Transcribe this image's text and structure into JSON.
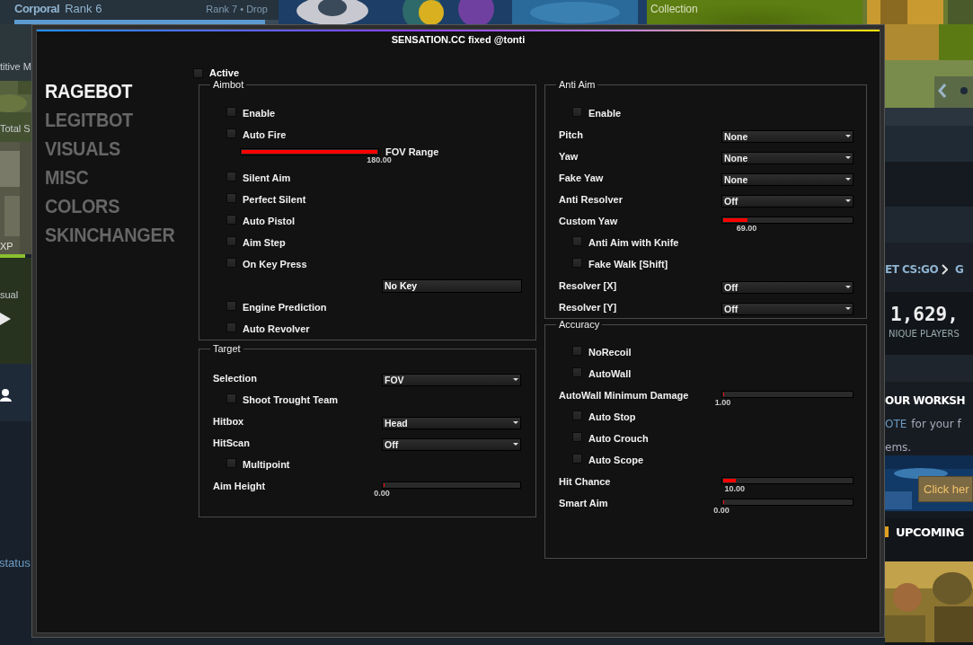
{
  "background": {
    "rank": {
      "title": "Corporal",
      "rank": "Rank 6",
      "next": "Rank 7 • Drop",
      "level": 0.95
    },
    "banner": "Collection",
    "left": {
      "mode": "titive M",
      "stats": "Total S",
      "xp": "XP",
      "mode2": "sual",
      "status": "status"
    },
    "right": {
      "nav": "ET CS:GO",
      "nav_next": "G",
      "count": "1,629,",
      "count_label": "NIQUE PLAYERS",
      "workshop_title": "OUR WORKSH",
      "workshop_link": "OTE",
      "workshop_text": "for your f",
      "workshop_text2": "ems.",
      "cta": "Click her",
      "upcoming": "UPCOMING"
    }
  },
  "menu": {
    "title": "SENSATION.CC fixed @tonti",
    "tabs": [
      {
        "label": "RAGEBOT",
        "selected": true
      },
      {
        "label": "LEGITBOT",
        "selected": false
      },
      {
        "label": "VISUALS",
        "selected": false
      },
      {
        "label": "MISC",
        "selected": false
      },
      {
        "label": "COLORS",
        "selected": false
      },
      {
        "label": "SKINCHANGER",
        "selected": false
      }
    ],
    "active": {
      "label": "Active",
      "checked": false
    },
    "columns": [
      [
        {
          "title": "Aimbot",
          "items": [
            {
              "kind": "checkbox",
              "label": "Enable",
              "checked": false
            },
            {
              "kind": "checkbox",
              "label": "Auto Fire",
              "checked": false
            },
            {
              "kind": "inline-slider",
              "label": "FOV Range",
              "level": 1,
              "reading": "180.00"
            },
            {
              "kind": "checkbox",
              "label": "Silent Aim",
              "checked": false
            },
            {
              "kind": "checkbox",
              "label": "Perfect Silent",
              "checked": false
            },
            {
              "kind": "checkbox",
              "label": "Auto Pistol",
              "checked": false
            },
            {
              "kind": "checkbox",
              "label": "Aim Step",
              "checked": false
            },
            {
              "kind": "checkbox",
              "label": "On Key Press",
              "checked": false
            },
            {
              "kind": "keybind",
              "value": "No Key"
            },
            {
              "kind": "checkbox",
              "label": "Engine Prediction",
              "checked": false
            },
            {
              "kind": "checkbox",
              "label": "Auto Revolver",
              "checked": false
            }
          ]
        },
        {
          "title": "Target",
          "items": [
            {
              "kind": "dropdown",
              "label": "Selection",
              "value": "FOV"
            },
            {
              "kind": "checkbox",
              "label": "Shoot Trought Team",
              "checked": false
            },
            {
              "kind": "dropdown",
              "label": "Hitbox",
              "value": "Head"
            },
            {
              "kind": "dropdown",
              "label": "HitScan",
              "value": "Off"
            },
            {
              "kind": "checkbox",
              "label": "Multipoint",
              "checked": false
            },
            {
              "kind": "slider",
              "label": "Aim Height",
              "level": 0,
              "reading": "0.00"
            }
          ]
        }
      ],
      [
        {
          "title": "Anti Aim",
          "items": [
            {
              "kind": "checkbox",
              "label": "Enable",
              "checked": false
            },
            {
              "kind": "dropdown",
              "label": "Pitch",
              "value": "None"
            },
            {
              "kind": "dropdown",
              "label": "Yaw",
              "value": "None"
            },
            {
              "kind": "dropdown",
              "label": "Fake Yaw",
              "value": "None"
            },
            {
              "kind": "dropdown",
              "label": "Anti Resolver",
              "value": "Off"
            },
            {
              "kind": "slider",
              "label": "Custom Yaw",
              "level": 0.19,
              "reading": "69.00"
            },
            {
              "kind": "checkbox",
              "label": "Anti Aim with Knife",
              "checked": false
            },
            {
              "kind": "checkbox",
              "label": "Fake Walk [Shift]",
              "checked": false
            },
            {
              "kind": "dropdown",
              "label": "Resolver [X]",
              "value": "Off"
            },
            {
              "kind": "dropdown",
              "label": "Resolver [Y]",
              "value": "Off"
            }
          ]
        },
        {
          "title": "Accuracy",
          "items": [
            {
              "kind": "checkbox",
              "label": "NoRecoil",
              "checked": false
            },
            {
              "kind": "checkbox",
              "label": "AutoWall",
              "checked": false
            },
            {
              "kind": "slider",
              "label": "AutoWall Minimum Damage",
              "level": 0.01,
              "reading": "1.00"
            },
            {
              "kind": "checkbox",
              "label": "Auto Stop",
              "checked": false
            },
            {
              "kind": "checkbox",
              "label": "Auto Crouch",
              "checked": false
            },
            {
              "kind": "checkbox",
              "label": "Auto Scope",
              "checked": false
            },
            {
              "kind": "slider",
              "label": "Hit Chance",
              "level": 0.1,
              "reading": "10.00"
            },
            {
              "kind": "slider",
              "label": "Smart Aim",
              "level": 0,
              "reading": "0.00"
            }
          ]
        }
      ]
    ]
  }
}
